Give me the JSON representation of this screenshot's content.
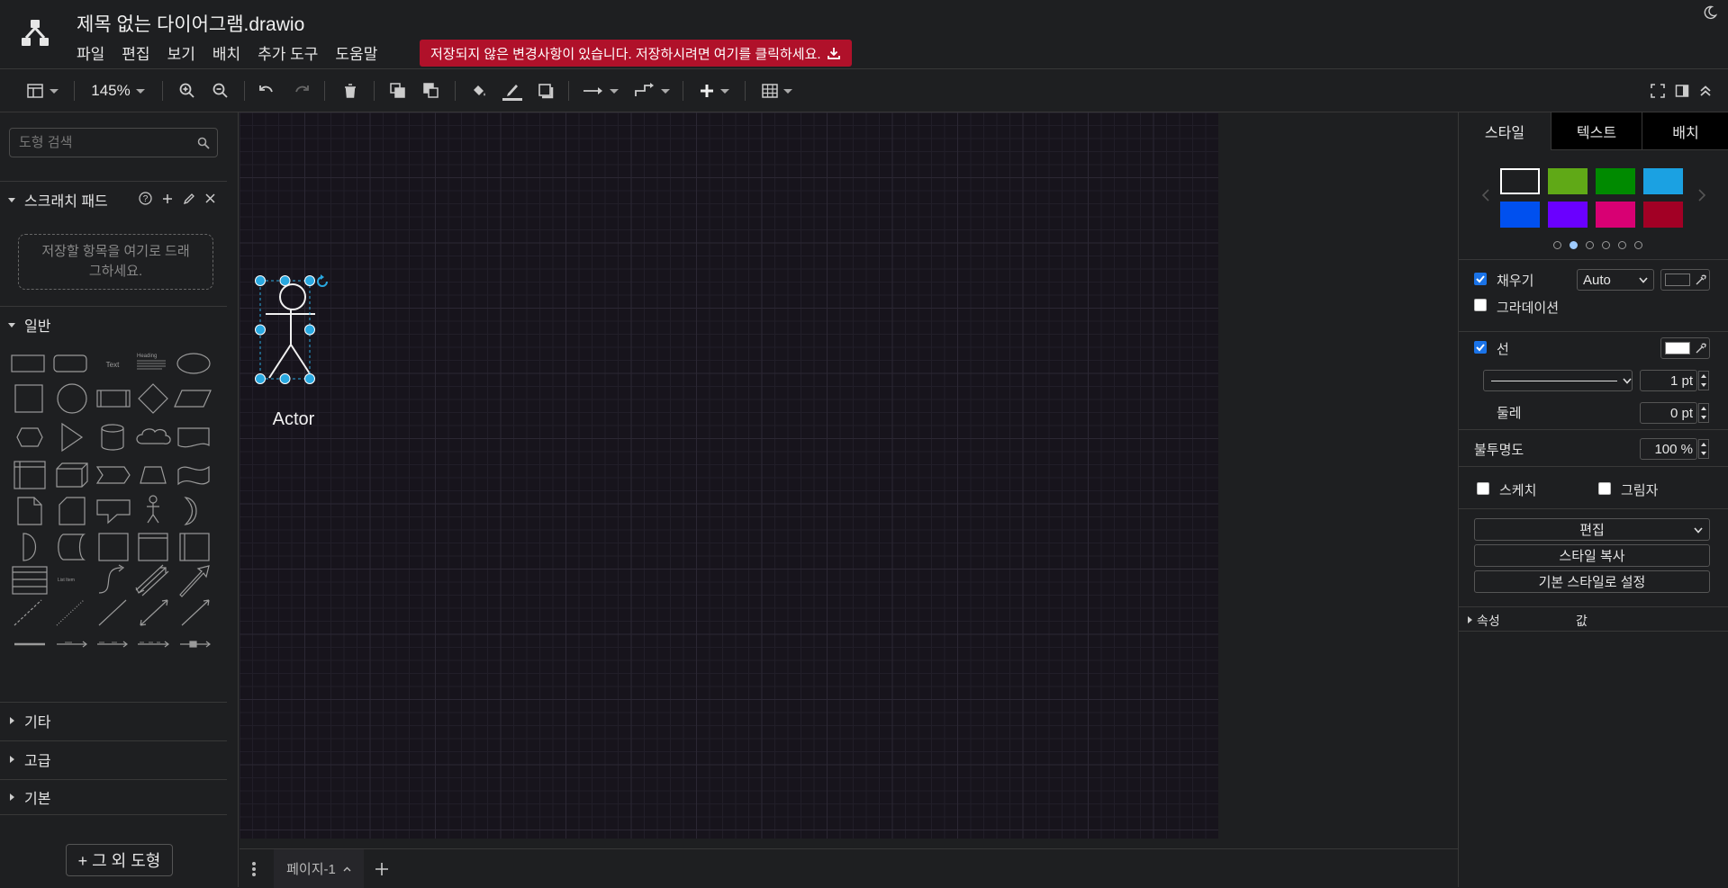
{
  "app": {
    "title": "제목 없는 다이어그램.drawio",
    "unsaved_banner": "저장되지 않은 변경사항이 있습니다. 저장하시려면 여기를 클릭하세요.",
    "menu": [
      "파일",
      "편집",
      "보기",
      "배치",
      "추가 도구",
      "도움말"
    ]
  },
  "toolbar": {
    "zoom": "145%"
  },
  "left_sidebar": {
    "search_placeholder": "도형 검색",
    "scratchpad": {
      "title": "스크래치 패드",
      "drop_hint_line1": "저장할 항목을 여기로 드래",
      "drop_hint_line2": "그하세요."
    },
    "general_title": "일반",
    "shape_texts": {
      "text": "Text",
      "heading": "Heading",
      "list_item": "List Item"
    },
    "sections_collapsed": [
      "기타",
      "고급",
      "기본"
    ],
    "more_shapes": "+ 그 외 도형"
  },
  "canvas": {
    "selected_shape_label": "Actor"
  },
  "pages": {
    "current": "페이지-1"
  },
  "format_panel": {
    "tabs": [
      "스타일",
      "텍스트",
      "배치"
    ],
    "active_tab": "스타일",
    "swatches": [
      "#1e1f21",
      "#60a917",
      "#008a00",
      "#1ba1e2",
      "#0050ef",
      "#6a00ff",
      "#d80073",
      "#a20025"
    ],
    "fill": {
      "label": "채우기",
      "checked": true,
      "mode": "Auto"
    },
    "gradient": {
      "label": "그라데이션",
      "checked": false
    },
    "line": {
      "label": "선",
      "checked": true,
      "width": "1 pt",
      "color": "#ffffff"
    },
    "perimeter": {
      "label": "둘레",
      "value": "0 pt"
    },
    "opacity": {
      "label": "불투명도",
      "value": "100 %"
    },
    "sketch": {
      "label": "스케치",
      "checked": false
    },
    "shadow": {
      "label": "그림자",
      "checked": false
    },
    "buttons": {
      "edit": "편집",
      "copy_style": "스타일 복사",
      "set_default": "기본 스타일로 설정"
    },
    "properties": {
      "col_property": "속성",
      "col_value": "값"
    }
  }
}
